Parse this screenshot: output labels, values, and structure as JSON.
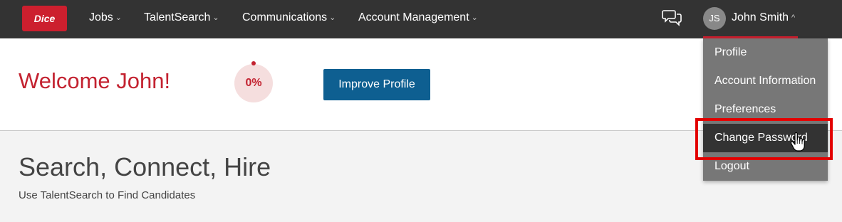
{
  "nav": {
    "logo_text": "Dice",
    "items": [
      {
        "label": "Jobs"
      },
      {
        "label": "TalentSearch"
      },
      {
        "label": "Communications"
      },
      {
        "label": "Account Management"
      }
    ],
    "chevron": "⌄",
    "chevron_up": "^",
    "user": {
      "initials": "JS",
      "name": "John Smith"
    }
  },
  "welcome": {
    "title": "Welcome John!",
    "progress_label": "0%",
    "improve_button": "Improve Profile"
  },
  "main": {
    "title": "Search, Connect, Hire",
    "subtitle": "Use TalentSearch to Find Candidates"
  },
  "dropdown": {
    "items": [
      {
        "label": "Profile"
      },
      {
        "label": "Account Information"
      },
      {
        "label": "Preferences"
      },
      {
        "label": "Change Password"
      },
      {
        "label": "Logout"
      }
    ]
  },
  "colors": {
    "brand_red": "#cc1f2e",
    "nav_bg": "#333333",
    "button_blue": "#0e5f91",
    "dropdown_bg": "#777777",
    "highlight": "#e30000"
  },
  "icons": [
    "chat-bubbles-icon",
    "chevron-down-icon",
    "chevron-up-icon",
    "hand-pointer-cursor-icon"
  ]
}
